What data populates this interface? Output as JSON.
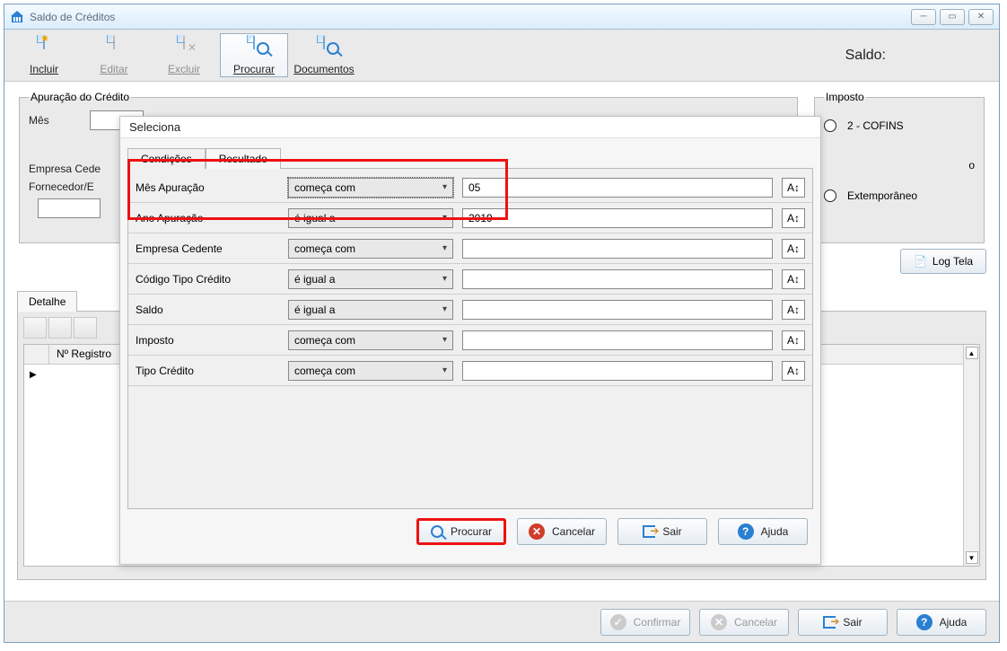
{
  "window": {
    "title": "Saldo de Créditos"
  },
  "toolbar": {
    "incluir": "Incluir",
    "editar": "Editar",
    "excluir": "Excluir",
    "procurar": "Procurar",
    "documentos": "Documentos",
    "saldo_label": "Saldo:"
  },
  "apuracao_group": {
    "legend": "Apuração do Crédito",
    "mes_label": "Mês",
    "empresa_cedente_label": "Empresa Cede",
    "fornecedor_label": "Fornecedor/E"
  },
  "imposto_group": {
    "legend": "Imposto",
    "cofins_label": "2 - COFINS",
    "extemp_label": "Extemporâneo",
    "marker_letter": "o"
  },
  "logtela_label": "Log Tela",
  "detalhe_tab": "Detalhe",
  "grid": {
    "col_registro": "Nº Registro"
  },
  "bottom": {
    "confirmar": "Confirmar",
    "cancelar": "Cancelar",
    "sair": "Sair",
    "ajuda": "Ajuda"
  },
  "modal": {
    "title": "Seleciona",
    "tab_condicoes": "Condições",
    "tab_resultado": "Resultado",
    "rows": [
      {
        "label": "Mês Apuração",
        "op": "começa com",
        "value": "05"
      },
      {
        "label": "Ano Apuração",
        "op": "é igual a",
        "value": "2019"
      },
      {
        "label": "Empresa Cedente",
        "op": "começa com",
        "value": ""
      },
      {
        "label": "Código Tipo Crédito",
        "op": "é igual a",
        "value": ""
      },
      {
        "label": "Saldo",
        "op": "é igual a",
        "value": ""
      },
      {
        "label": "Imposto",
        "op": "começa com",
        "value": ""
      },
      {
        "label": "Tipo Crédito",
        "op": "começa com",
        "value": ""
      }
    ],
    "btn_procurar": "Procurar",
    "btn_cancelar": "Cancelar",
    "btn_sair": "Sair",
    "btn_ajuda": "Ajuda"
  }
}
